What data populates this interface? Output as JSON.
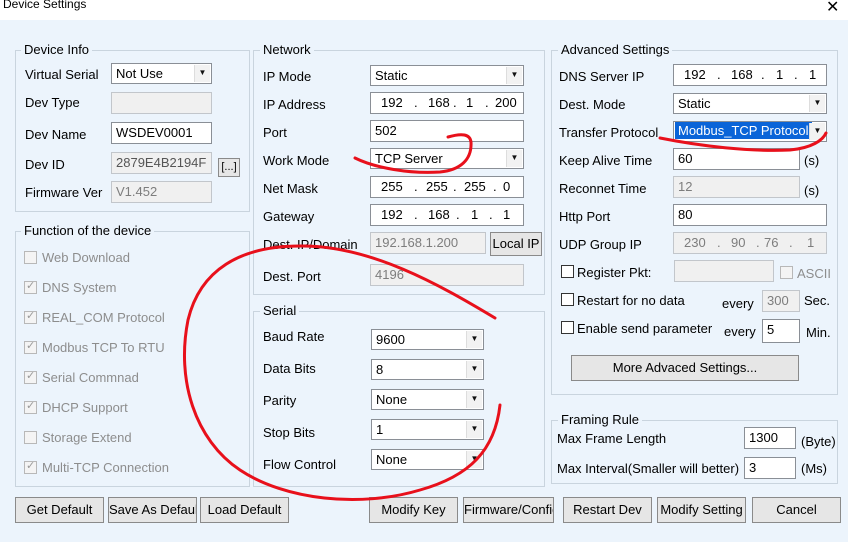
{
  "window": {
    "title": "Device Settings",
    "close_glyph": "✕"
  },
  "device_info": {
    "group_label": "Device Info",
    "virtual_serial_label": "Virtual Serial",
    "virtual_serial_value": "Not Use",
    "dev_type_label": "Dev Type",
    "dev_type_value": "",
    "dev_name_label": "Dev Name",
    "dev_name_value": "WSDEV0001",
    "dev_id_label": "Dev ID",
    "dev_id_value": "2879E4B2194F",
    "dev_id_button": "[...]",
    "firmware_label": "Firmware Ver",
    "firmware_value": "V1.452"
  },
  "functions": {
    "group_label": "Function of the device",
    "items": [
      {
        "label": "Web Download",
        "checked": false
      },
      {
        "label": "DNS System",
        "checked": true
      },
      {
        "label": "REAL_COM Protocol",
        "checked": true
      },
      {
        "label": "Modbus TCP To RTU",
        "checked": true
      },
      {
        "label": "Serial Commnad",
        "checked": true
      },
      {
        "label": "DHCP Support",
        "checked": true
      },
      {
        "label": "Storage Extend",
        "checked": false
      },
      {
        "label": "Multi-TCP Connection",
        "checked": true
      }
    ]
  },
  "network": {
    "group_label": "Network",
    "ip_mode_label": "IP Mode",
    "ip_mode_value": "Static",
    "ip_address_label": "IP Address",
    "ip_address": [
      "192",
      "168",
      "1",
      "200"
    ],
    "port_label": "Port",
    "port_value": "502",
    "work_mode_label": "Work Mode",
    "work_mode_value": "TCP Server",
    "net_mask_label": "Net Mask",
    "net_mask": [
      "255",
      "255",
      "255",
      "0"
    ],
    "gateway_label": "Gateway",
    "gateway": [
      "192",
      "168",
      "1",
      "1"
    ],
    "dest_ip_label": "Dest. IP/Domain",
    "dest_ip_value": "192.168.1.200",
    "local_ip_button": "Local IP",
    "dest_port_label": "Dest. Port",
    "dest_port_value": "4196"
  },
  "serial": {
    "group_label": "Serial",
    "baud_rate_label": "Baud Rate",
    "baud_rate_value": "9600",
    "data_bits_label": "Data Bits",
    "data_bits_value": "8",
    "parity_label": "Parity",
    "parity_value": "None",
    "stop_bits_label": "Stop Bits",
    "stop_bits_value": "1",
    "flow_control_label": "Flow Control",
    "flow_control_value": "None"
  },
  "advanced": {
    "group_label": "Advanced Settings",
    "dns_label": "DNS Server IP",
    "dns_ip": [
      "192",
      "168",
      "1",
      "1"
    ],
    "dest_mode_label": "Dest. Mode",
    "dest_mode_value": "Static",
    "transfer_protocol_label": "Transfer Protocol",
    "transfer_protocol_value": "Modbus_TCP Protocol",
    "keep_alive_label": "Keep Alive Time",
    "keep_alive_value": "60",
    "keep_alive_unit": "(s)",
    "reconnect_label": "Reconnet Time",
    "reconnect_value": "12",
    "reconnect_unit": "(s)",
    "http_port_label": "Http Port",
    "http_port_value": "80",
    "udp_group_label": "UDP Group IP",
    "udp_group_ip": [
      "230",
      "90",
      "76",
      "1"
    ],
    "register_pkt_label": "Register Pkt:",
    "register_pkt_value": "",
    "ascii_label": "ASCII",
    "restart_label": "Restart for no data",
    "restart_every": "every",
    "restart_value": "300",
    "restart_unit": "Sec.",
    "enable_send_label": "Enable send parameter",
    "enable_send_every": "every",
    "enable_send_value": "5",
    "enable_send_unit": "Min.",
    "more_button": "More Advaced Settings..."
  },
  "framing": {
    "group_label": "Framing Rule",
    "max_frame_label": "Max Frame Length",
    "max_frame_value": "1300",
    "max_frame_unit": "(Byte)",
    "max_interval_label": "Max Interval(Smaller will better)",
    "max_interval_value": "3",
    "max_interval_unit": "(Ms)"
  },
  "buttons": {
    "get_default": "Get Default",
    "save_as_default": "Save As Default",
    "load_default": "Load Default",
    "modify_key": "Modify Key",
    "firmware_config": "Firmware/Config",
    "restart_dev": "Restart Dev",
    "modify_setting": "Modify Setting",
    "cancel": "Cancel"
  },
  "colors": {
    "background": "#ecf4fc",
    "annotation_red": "#e8101b",
    "selection_blue": "#0a64d8"
  }
}
